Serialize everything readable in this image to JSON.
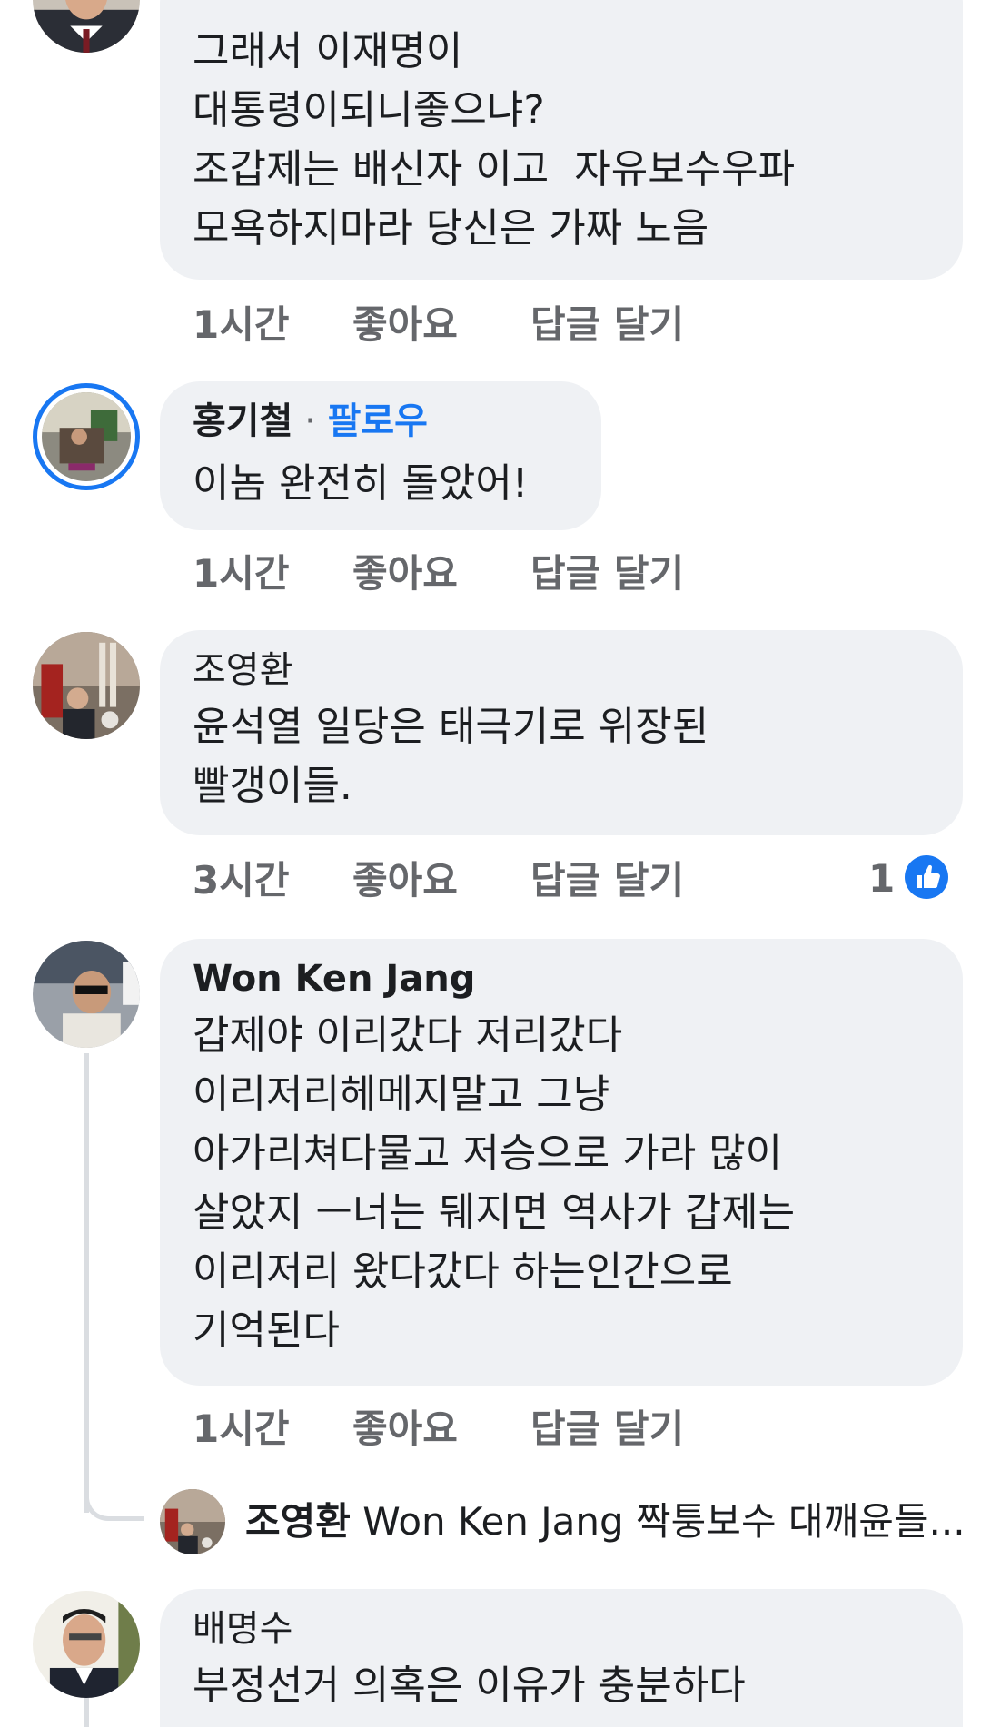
{
  "comments": [
    {
      "id": "c1",
      "author": "",
      "body": "그래서 이재명이\n대통령이되니좋으냐?\n조갑제는 배신자 이고  자유보수우파\n모욕하지마라 당신은 가짜 노음",
      "time": "1시간",
      "like_label": "좋아요",
      "reply_label": "답글 달기"
    },
    {
      "id": "c2",
      "author": "홍기철",
      "separator": "·",
      "follow_label": "팔로우",
      "body": "이놈 완전히 돌았어!",
      "time": "1시간",
      "like_label": "좋아요",
      "reply_label": "답글 달기"
    },
    {
      "id": "c3",
      "author": "조영환",
      "body": "윤석열 일당은 태극기로 위장된\n빨갱이들.",
      "time": "3시간",
      "like_label": "좋아요",
      "reply_label": "답글 달기",
      "reaction_count": "1",
      "reaction_icon": "thumbs-up-icon",
      "reaction_color": "#1877f2"
    },
    {
      "id": "c4",
      "author": "Won Ken Jang",
      "body": "갑제야 이리갔다 저리갔다\n이리저리헤메지말고 그냥\n아가리쳐다물고 저승으로 가라 많이\n살았지 ㅡ너는 뒈지면 역사가 갑제는\n이리저리 왔다갔다 하는인간으로\n기억된다",
      "time": "1시간",
      "like_label": "좋아요",
      "reply_label": "답글 달기"
    },
    {
      "id": "c5",
      "author": "배명수",
      "body": "부정선거 의혹은 이유가 충분하다",
      "time": "",
      "like_label": "",
      "reply_label": ""
    }
  ],
  "reply_preview": {
    "author": "조영환",
    "text": "Won Ken Jang 짝퉁보수 대깨윤들..."
  },
  "colors": {
    "bubble": "#eff1f4",
    "link": "#1877f2",
    "meta": "#65676b",
    "text": "#1c1e21",
    "thread_line": "#dadde1"
  }
}
